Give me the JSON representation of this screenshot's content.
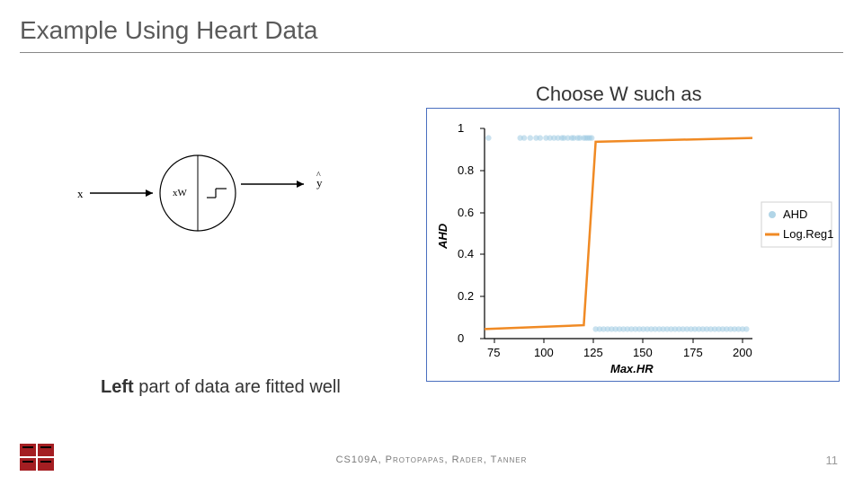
{
  "title": "Example Using Heart Data",
  "instruction": "Choose W such as",
  "caption_bold": "Left",
  "caption_rest": " part of data are fitted well",
  "footer": "CS109A, Protopapas, Rader, Tanner",
  "page_number": "11",
  "diagram": {
    "input_label": "x",
    "node_label": "xW",
    "output_label": "y"
  },
  "legend": {
    "series1": "AHD",
    "series2": "Log.Reg1"
  },
  "chart_data": {
    "type": "line",
    "title": "",
    "xlabel": "Max.HR",
    "ylabel": "AHD",
    "xlim": [
      70,
      205
    ],
    "ylim": [
      -0.05,
      1.05
    ],
    "x_ticks": [
      75,
      100,
      125,
      150,
      175,
      200
    ],
    "y_ticks": [
      0.0,
      0.2,
      0.4,
      0.6,
      0.8,
      1.0
    ],
    "series": [
      {
        "name": "AHD",
        "type": "scatter",
        "color": "#9ecae1",
        "x": [
          72,
          88,
          90,
          93,
          96,
          98,
          101,
          103,
          105,
          107,
          109,
          110,
          112,
          114,
          115,
          117,
          118,
          120,
          121,
          122,
          123,
          124,
          126,
          128,
          130,
          132,
          134,
          136,
          138,
          140,
          142,
          144,
          146,
          148,
          150,
          152,
          154,
          156,
          158,
          160,
          162,
          164,
          166,
          168,
          170,
          172,
          174,
          176,
          178,
          180,
          182,
          184,
          186,
          188,
          190,
          192,
          194,
          196,
          198,
          200,
          202
        ],
        "y": [
          1,
          1,
          1,
          1,
          1,
          1,
          1,
          1,
          1,
          1,
          1,
          1,
          1,
          1,
          1,
          1,
          1,
          1,
          1,
          1,
          1,
          1,
          0,
          0,
          0,
          0,
          0,
          0,
          0,
          0,
          0,
          0,
          0,
          0,
          0,
          0,
          0,
          0,
          0,
          0,
          0,
          0,
          0,
          0,
          0,
          0,
          0,
          0,
          0,
          0,
          0,
          0,
          0,
          0,
          0,
          0,
          0,
          0,
          0,
          0,
          0
        ]
      },
      {
        "name": "Log.Reg1",
        "type": "line",
        "color": "#f08a24",
        "x": [
          70,
          120,
          123,
          126,
          205
        ],
        "y": [
          0.0,
          0.02,
          0.5,
          0.98,
          1.0
        ]
      }
    ]
  }
}
